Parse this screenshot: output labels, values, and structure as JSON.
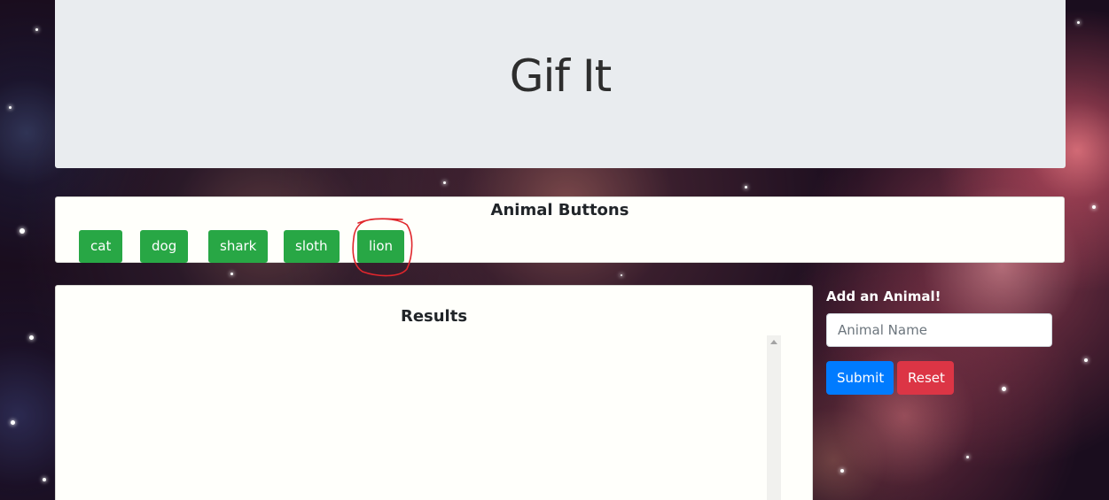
{
  "header": {
    "title": "Gif It"
  },
  "animal_buttons": {
    "title": "Animal Buttons",
    "items": [
      {
        "label": "cat"
      },
      {
        "label": "dog"
      },
      {
        "label": "shark"
      },
      {
        "label": "sloth"
      },
      {
        "label": "lion"
      }
    ],
    "button_color": "#28a745",
    "annotation_color": "#e0262c"
  },
  "results": {
    "title": "Results"
  },
  "add_form": {
    "label": "Add an Animal!",
    "input_value": "",
    "input_placeholder": "Animal Name",
    "submit_label": "Submit",
    "reset_label": "Reset",
    "submit_color": "#007bff",
    "reset_color": "#dc3545"
  }
}
